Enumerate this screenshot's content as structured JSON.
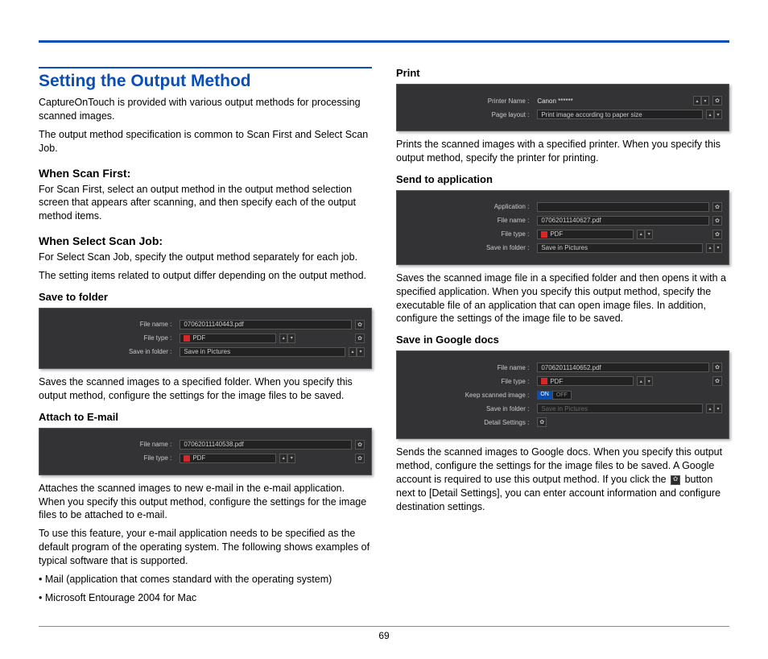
{
  "page_number": "69",
  "heading": "Setting the Output Method",
  "intro1": "CaptureOnTouch is provided with various output methods for processing scanned images.",
  "intro2": "The output method specification is common to Scan First and Select Scan Job.",
  "scan_first": {
    "title": "When Scan First:",
    "body": "For Scan First, select an output method in the output method selection screen that appears after scanning, and then specify each of the output method items."
  },
  "select_scan": {
    "title": "When Select Scan Job:",
    "body1": "For Select Scan Job, specify the output method separately for each job.",
    "body2": "The setting items related to output differ depending on the output method."
  },
  "save_to_folder": {
    "title": "Save to folder",
    "fields": {
      "filename_label": "File name :",
      "filename_value": "07062011140443.pdf",
      "filetype_label": "File type :",
      "filetype_value": "PDF",
      "savein_label": "Save in folder :",
      "savein_value": "Save in Pictures"
    },
    "body": "Saves the scanned images to a specified folder. When you specify this output method, configure the settings for the image files to be saved."
  },
  "attach_email": {
    "title": "Attach to E-mail",
    "fields": {
      "filename_label": "File name :",
      "filename_value": "07062011140538.pdf",
      "filetype_label": "File type :",
      "filetype_value": "PDF"
    },
    "body1": "Attaches the scanned images to new e-mail in the e-mail application. When you specify this output method, configure the settings for the image files to be attached to e-mail.",
    "body2": "To use this feature, your e-mail application needs to be specified as the default program of the operating system. The following shows examples of typical software that is supported.",
    "bullets": [
      "Mail (application that comes standard with the operating system)",
      "Microsoft Entourage 2004 for Mac"
    ]
  },
  "print": {
    "title": "Print",
    "fields": {
      "printer_label": "Printer Name :",
      "printer_value": "Canon ******",
      "layout_label": "Page layout :",
      "layout_value": "Print image according to paper size"
    },
    "body": "Prints the scanned images with a specified printer. When you specify this output method, specify the printer for printing."
  },
  "send_app": {
    "title": "Send to application",
    "fields": {
      "app_label": "Application :",
      "filename_label": "File name :",
      "filename_value": "07062011140627.pdf",
      "filetype_label": "File type :",
      "filetype_value": "PDF",
      "savein_label": "Save in folder :",
      "savein_value": "Save in Pictures"
    },
    "body": "Saves the scanned image file in a specified folder and then opens it with a specified application. When you specify this output method, specify the executable file of an application that can open image files. In addition, configure the settings of the image file to be saved."
  },
  "google_docs": {
    "title": "Save in Google docs",
    "fields": {
      "filename_label": "File name :",
      "filename_value": "07062011140652.pdf",
      "filetype_label": "File type :",
      "filetype_value": "PDF",
      "keep_label": "Keep scanned image :",
      "keep_on": "ON",
      "keep_off": "OFF",
      "savein_label": "Save in folder :",
      "savein_value": "Save in Pictures",
      "detail_label": "Detail Settings :"
    },
    "body1": "Sends the scanned images to Google docs. When you specify this output method, configure the settings for the image files to be saved. A Google account is required to use this output method. If you click the",
    "body2": "button next to [Detail Settings], you can enter account information and configure destination settings."
  }
}
